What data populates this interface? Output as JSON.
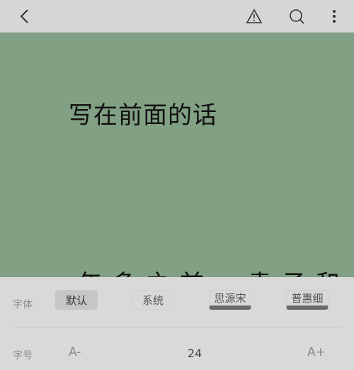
{
  "reader": {
    "chapter_title": "写在前面的话",
    "body_line": "年多之前，袁子和仇衡分手"
  },
  "settings": {
    "font_label": "字体",
    "fonts": [
      "默认",
      "系统",
      "思源宋",
      "普惠细"
    ],
    "selected_font": "默认",
    "size_label": "字号",
    "size_decrease": "A-",
    "size_value": "24",
    "size_increase": "A+"
  },
  "icons": {
    "back": "back-arrow-icon",
    "report": "warning-icon",
    "search": "search-icon",
    "more": "more-vertical-icon"
  },
  "colors": {
    "reading_background": "#82a083",
    "panel_background": "#d9d9d9"
  }
}
